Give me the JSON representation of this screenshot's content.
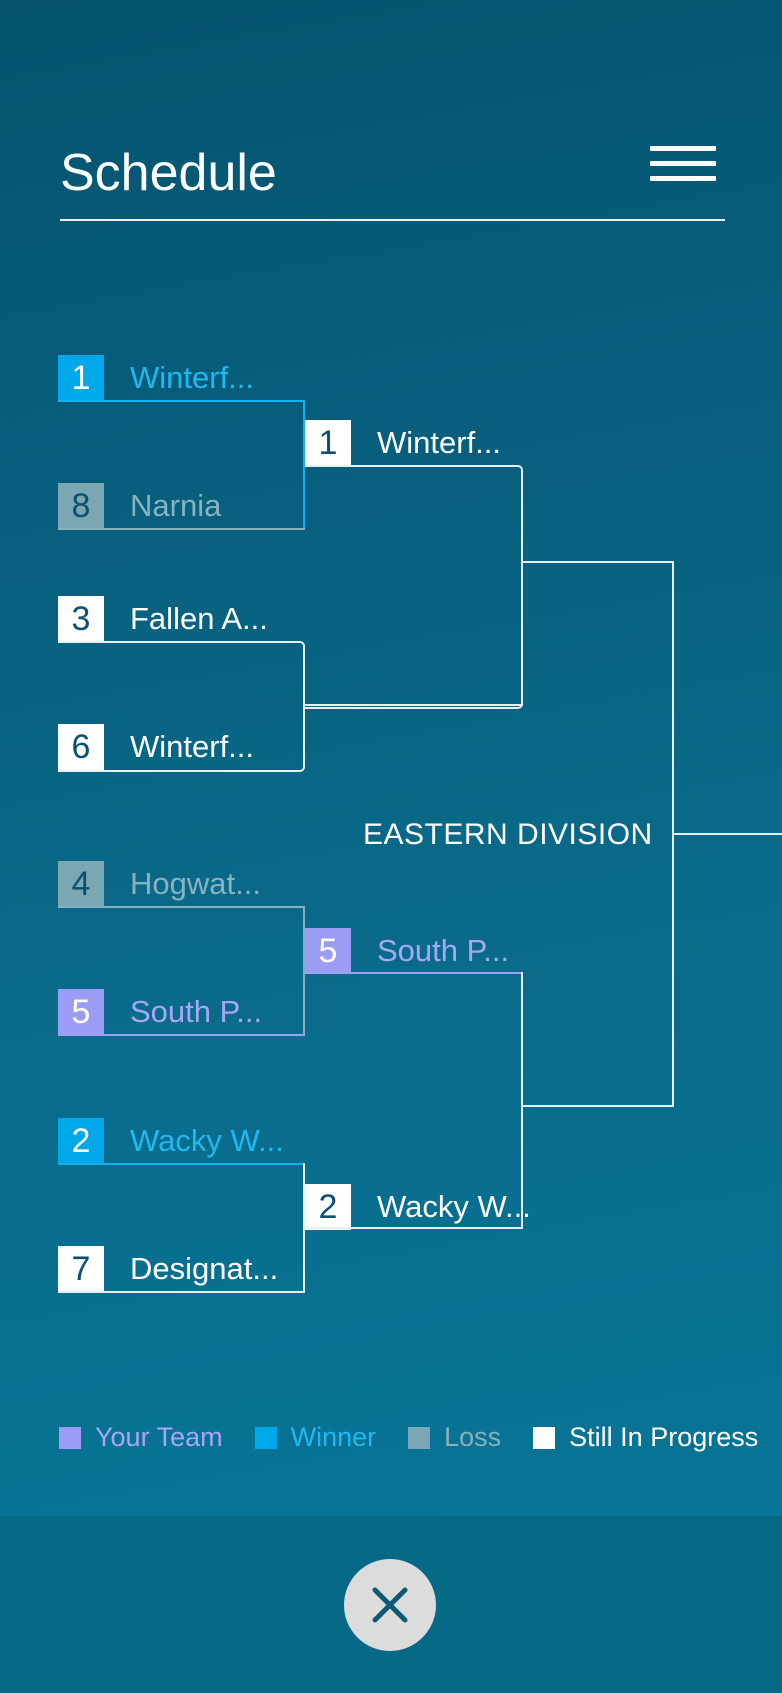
{
  "header": {
    "title": "Schedule"
  },
  "icons": {
    "menu": "hamburger-menu-icon",
    "close": "close-icon"
  },
  "colors": {
    "your_team": "#9b9cf5",
    "winner": "#00a7e9",
    "loss": "#7aa7b3",
    "in_progress": "#ffffff"
  },
  "bracket": {
    "division": "EASTERN DIVISION",
    "round1": [
      {
        "seed": "1",
        "name": "Winterf...",
        "status": "winner"
      },
      {
        "seed": "8",
        "name": "Narnia",
        "status": "loss"
      },
      {
        "seed": "3",
        "name": "Fallen A...",
        "status": "in_progress"
      },
      {
        "seed": "6",
        "name": "Winterf...",
        "status": "in_progress"
      },
      {
        "seed": "4",
        "name": "Hogwat...",
        "status": "loss"
      },
      {
        "seed": "5",
        "name": "South P...",
        "status": "your_team"
      },
      {
        "seed": "2",
        "name": "Wacky W...",
        "status": "winner"
      },
      {
        "seed": "7",
        "name": "Designat...",
        "status": "in_progress"
      }
    ],
    "round2": [
      {
        "seed": "1",
        "name": "Winterf...",
        "status": "in_progress"
      },
      {
        "seed": "5",
        "name": "South P...",
        "status": "your_team"
      },
      {
        "seed": "2",
        "name": "Wacky W...",
        "status": "in_progress"
      }
    ]
  },
  "legend": [
    {
      "label": "Your Team",
      "key": "your_team"
    },
    {
      "label": "Winner",
      "key": "winner"
    },
    {
      "label": "Loss",
      "key": "loss"
    },
    {
      "label": "Still In Progress",
      "key": "in_progress"
    }
  ]
}
